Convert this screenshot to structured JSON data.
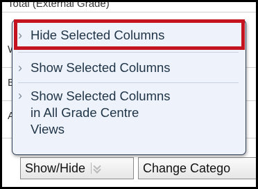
{
  "background": {
    "rows": [
      {
        "text": "Total (External Grade)"
      },
      {
        "text": "W"
      },
      {
        "text": "Bl"
      },
      {
        "text": "A"
      }
    ]
  },
  "menu": {
    "items": [
      {
        "chevron": "›",
        "label": "Hide Selected Columns",
        "highlighted": true
      },
      {
        "chevron": "›",
        "label": "Show Selected Columns",
        "highlighted": false
      },
      {
        "chevron": "›",
        "label": "Show Selected Columns\nin All Grade Centre\nViews",
        "highlighted": false
      }
    ],
    "highlight_color": "#c3141f",
    "background_color": "#eef3fb"
  },
  "toolbar": {
    "show_hide_label": "Show/Hide",
    "show_hide_icon": "double-chevron-down-icon",
    "change_category_label": "Change Catego"
  }
}
